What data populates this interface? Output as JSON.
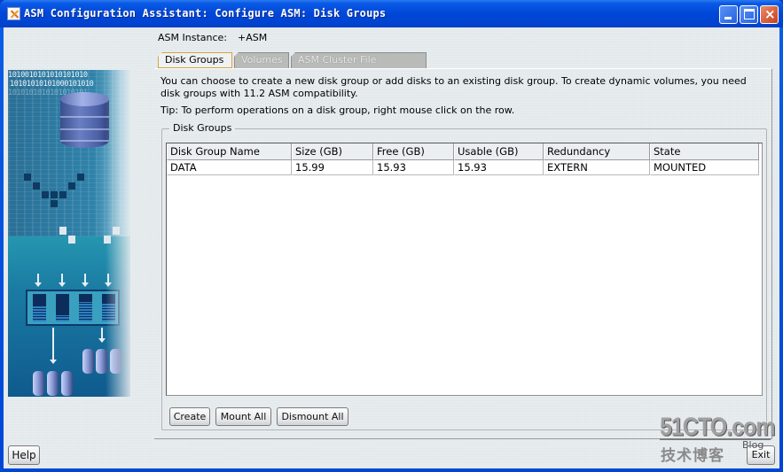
{
  "window": {
    "title": "ASM Configuration Assistant: Configure ASM: Disk Groups",
    "controls": {
      "minimize": "minimize",
      "maximize": "maximize",
      "close": "×"
    }
  },
  "side_art": {
    "binary_lines": [
      "1010010101010101010",
      "10101010101000101010",
      "1010101010101010101"
    ]
  },
  "instance": {
    "label": "ASM Instance:",
    "value": "+ASM"
  },
  "tabs": [
    {
      "label": "Disk Groups",
      "state": "active"
    },
    {
      "label": "Volumes",
      "state": "disabled"
    },
    {
      "label": "ASM Cluster File Systems",
      "state": "disabled"
    }
  ],
  "description": "You can choose to create a new disk group or add disks to an existing disk group. To create dynamic volumes, you need disk groups with 11.2 ASM compatibility.",
  "tip": "Tip: To perform operations on a disk group, right mouse click on the row.",
  "disk_groups": {
    "title": "Disk Groups",
    "columns": [
      "Disk Group Name",
      "Size (GB)",
      "Free (GB)",
      "Usable (GB)",
      "Redundancy",
      "State"
    ],
    "rows": [
      [
        "DATA",
        "15.99",
        "15.93",
        "15.93",
        "EXTERN",
        "MOUNTED"
      ]
    ],
    "buttons": {
      "create": "Create",
      "mount_all": "Mount All",
      "dismount_all": "Dismount All"
    }
  },
  "footer": {
    "help": "Help",
    "exit": "Exit"
  },
  "watermark": {
    "site": "51CTO.com",
    "cn": "技术博客",
    "blog": "Blog"
  }
}
